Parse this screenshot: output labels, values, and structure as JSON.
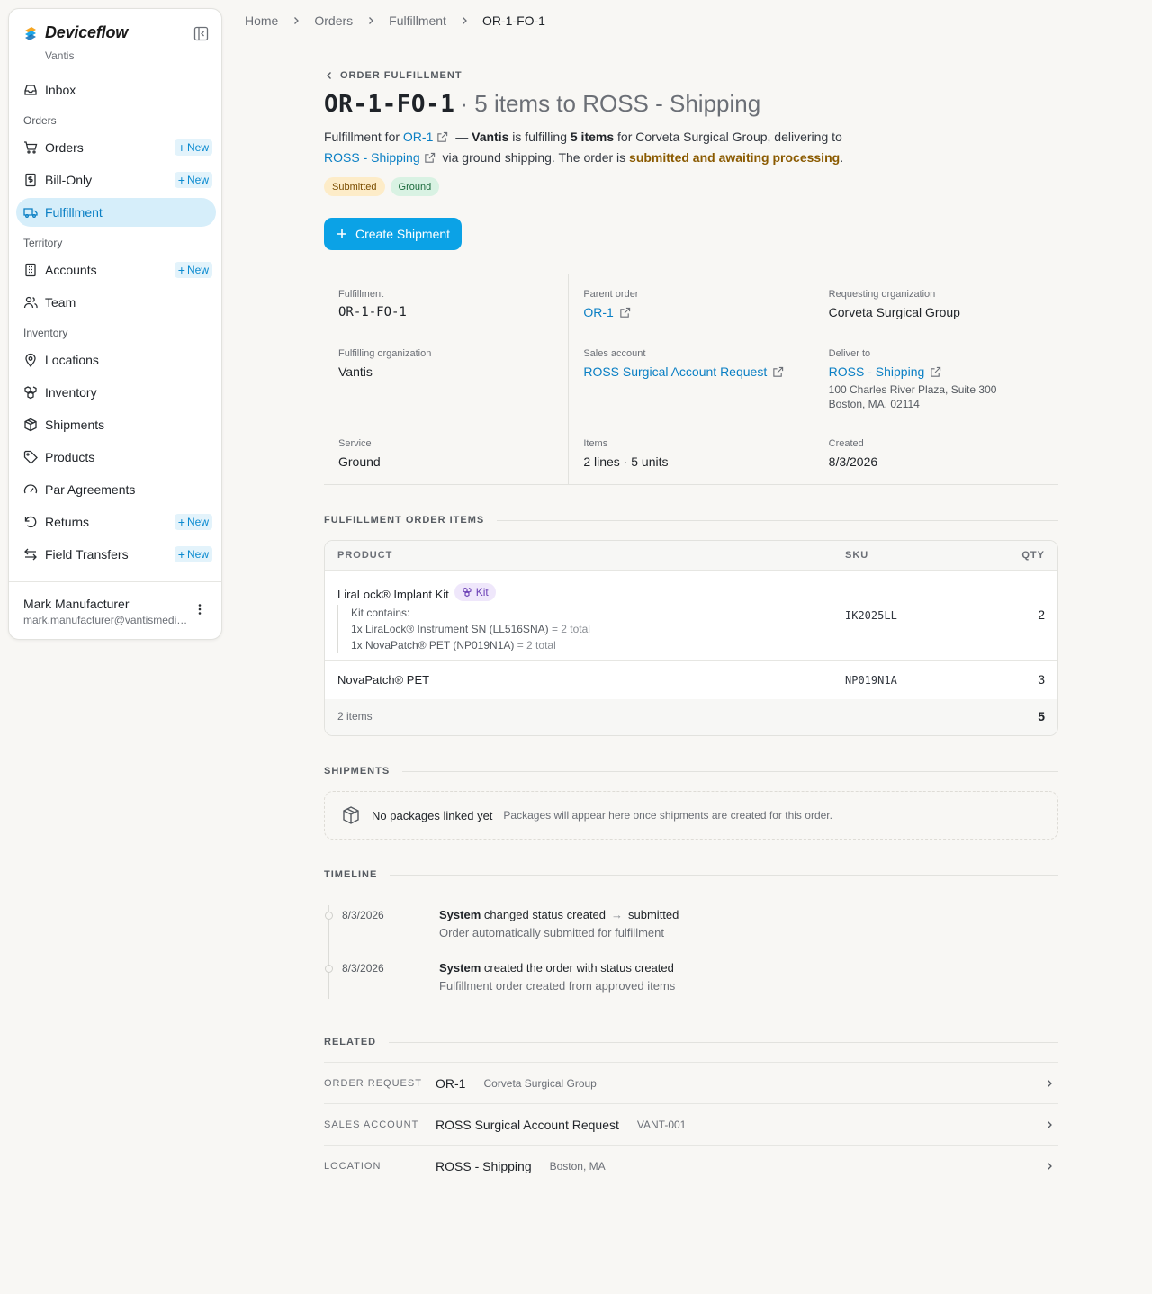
{
  "app": {
    "name": "Deviceflow",
    "org": "Vantis"
  },
  "sidebar": {
    "inbox": "Inbox",
    "sections": {
      "orders": "Orders",
      "territory": "Territory",
      "inventory": "Inventory"
    },
    "items": {
      "orders": "Orders",
      "bill_only": "Bill-Only",
      "fulfillment": "Fulfillment",
      "accounts": "Accounts",
      "team": "Team",
      "locations": "Locations",
      "inventory": "Inventory",
      "shipments": "Shipments",
      "products": "Products",
      "par_agreements": "Par Agreements",
      "returns": "Returns",
      "field_transfers": "Field Transfers"
    },
    "new_label": "New",
    "user": {
      "name": "Mark Manufacturer",
      "email": "mark.manufacturer@vantismedical.com"
    }
  },
  "breadcrumb": [
    "Home",
    "Orders",
    "Fulfillment",
    "OR-1-FO-1"
  ],
  "header": {
    "eyebrow": "ORDER FULFILLMENT",
    "code": "OR-1-FO-1",
    "subtitle": "· 5 items to ROSS - Shipping",
    "summary": {
      "p1": "Fulfillment for ",
      "order_link": "OR-1",
      "p2": " — ",
      "org": "Vantis",
      "p3": " is fulfilling ",
      "items": "5 items",
      "p4": " for Corveta Surgical Group, delivering to",
      "loc_link": "ROSS - Shipping",
      "p5": " via ground shipping. The order is ",
      "status": "submitted and awaiting processing",
      "p6": "."
    },
    "badges": {
      "status": "Submitted",
      "service": "Ground"
    },
    "create_button": "Create Shipment"
  },
  "details": {
    "fulfillment": {
      "label": "Fulfillment",
      "value": "OR-1-FO-1"
    },
    "parent_order": {
      "label": "Parent order",
      "value": "OR-1"
    },
    "requesting_org": {
      "label": "Requesting organization",
      "value": "Corveta Surgical Group"
    },
    "fulfilling_org": {
      "label": "Fulfilling organization",
      "value": "Vantis"
    },
    "sales_account": {
      "label": "Sales account",
      "value": "ROSS Surgical Account Request"
    },
    "deliver_to": {
      "label": "Deliver to",
      "value": "ROSS - Shipping",
      "addr1": "100 Charles River Plaza, Suite 300",
      "addr2": "Boston, MA, 02114"
    },
    "service": {
      "label": "Service",
      "value": "Ground"
    },
    "items": {
      "label": "Items",
      "value": "2 lines · 5 units"
    },
    "created": {
      "label": "Created",
      "value": "8/3/2026"
    }
  },
  "items_section": {
    "title": "FULFILLMENT ORDER ITEMS",
    "columns": {
      "product": "PRODUCT",
      "sku": "SKU",
      "qty": "QTY"
    },
    "rows": [
      {
        "product": "LiraLock® Implant Kit",
        "badge": "Kit",
        "sku": "IK2025LL",
        "qty": "2",
        "kit_label": "Kit contains:",
        "kit_lines": [
          {
            "text": "1x LiraLock® Instrument SN (LL516SNA)",
            "total": " = 2 total"
          },
          {
            "text": "1x NovaPatch® PET (NP019N1A)",
            "total": " = 2 total"
          }
        ]
      },
      {
        "product": "NovaPatch® PET",
        "sku": "NP019N1A",
        "qty": "3"
      }
    ],
    "footer": {
      "count": "2 items",
      "total": "5"
    }
  },
  "shipments_section": {
    "title": "SHIPMENTS",
    "empty_title": "No packages linked yet",
    "empty_sub": "Packages will appear here once shipments are created for this order."
  },
  "timeline_section": {
    "title": "TIMELINE",
    "events": [
      {
        "date": "8/3/2026",
        "actor": "System",
        "action": " changed status created",
        "arrow": "→",
        "to": "submitted",
        "note": "Order automatically submitted for fulfillment"
      },
      {
        "date": "8/3/2026",
        "actor": "System",
        "action": " created the order with status created",
        "note": "Fulfillment order created from approved items"
      }
    ]
  },
  "related_section": {
    "title": "RELATED",
    "rows": [
      {
        "key": "ORDER REQUEST",
        "value": "OR-1",
        "detail": "Corveta Surgical Group"
      },
      {
        "key": "SALES ACCOUNT",
        "value": "ROSS Surgical Account Request",
        "detail": "VANT-001"
      },
      {
        "key": "LOCATION",
        "value": "ROSS - Shipping",
        "detail": "Boston, MA"
      }
    ]
  },
  "colors": {
    "accent": "#0ba2e6",
    "link": "#0a7fc4",
    "active_nav_bg": "#d6eefa"
  }
}
